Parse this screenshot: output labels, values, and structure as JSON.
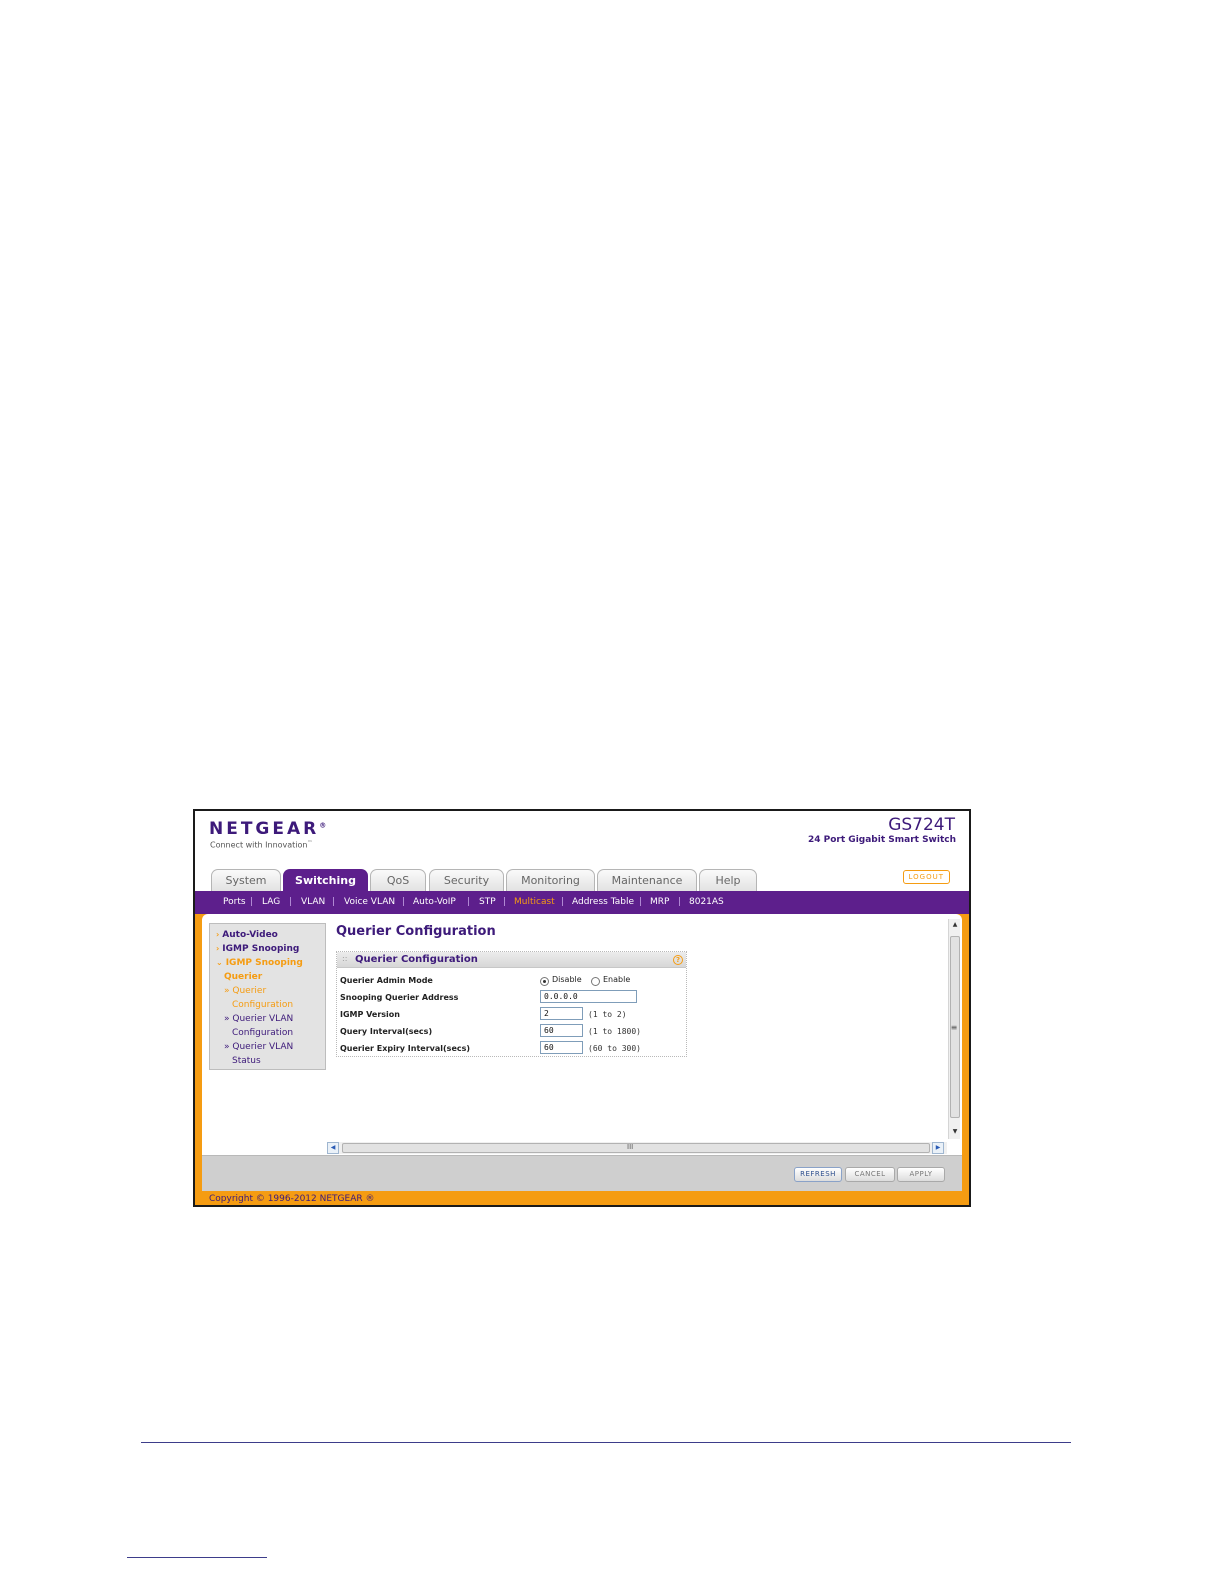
{
  "brand": {
    "logo": "NETGEAR",
    "logo_mark": "®",
    "tagline": "Connect with Innovation",
    "tagline_mark": "™",
    "model": "GS724T",
    "model_desc": "24 Port Gigabit Smart Switch"
  },
  "tabs": [
    {
      "label": "System"
    },
    {
      "label": "Switching"
    },
    {
      "label": "QoS"
    },
    {
      "label": "Security"
    },
    {
      "label": "Monitoring"
    },
    {
      "label": "Maintenance"
    },
    {
      "label": "Help"
    }
  ],
  "active_tab": "Switching",
  "logout_label": "LOGOUT",
  "subnav": [
    {
      "label": "Ports"
    },
    {
      "label": "LAG"
    },
    {
      "label": "VLAN"
    },
    {
      "label": "Voice VLAN"
    },
    {
      "label": "Auto-VoIP"
    },
    {
      "label": "STP"
    },
    {
      "label": "Multicast"
    },
    {
      "label": "Address Table"
    },
    {
      "label": "MRP"
    },
    {
      "label": "8021AS"
    }
  ],
  "subnav_separator": "|",
  "active_subnav": "Multicast",
  "sidebar": {
    "items": [
      {
        "label": "Auto-Video"
      },
      {
        "label": "IGMP Snooping"
      },
      {
        "label": "IGMP Snooping"
      },
      {
        "label": "Querier"
      }
    ],
    "subitems": [
      {
        "label": "Querier"
      },
      {
        "label": "Configuration"
      },
      {
        "label": "Querier VLAN"
      },
      {
        "label": "Configuration"
      },
      {
        "label": "Querier VLAN"
      },
      {
        "label": "Status"
      }
    ],
    "chevron_collapsed": "›",
    "chevron_expanded": "⌄",
    "sub_bullet": "»"
  },
  "page_title": "Querier Configuration",
  "panel": {
    "title": "Querier Configuration",
    "help_icon": "?",
    "rows": {
      "admin_mode": {
        "label": "Querier Admin Mode",
        "options": [
          "Disable",
          "Enable"
        ],
        "selected": "Disable"
      },
      "address": {
        "label": "Snooping Querier Address",
        "value": "0.0.0.0"
      },
      "version": {
        "label": "IGMP Version",
        "value": "2",
        "range": "(1 to 2)"
      },
      "interval": {
        "label": "Query Interval(secs)",
        "value": "60",
        "range": "(1 to 1800)"
      },
      "expiry": {
        "label": "Querier Expiry Interval(secs)",
        "value": "60",
        "range": "(60 to 300)"
      }
    }
  },
  "scroll": {
    "up": "▲",
    "down": "▼",
    "left": "◀",
    "right": "▶",
    "grip_v": "≡",
    "grip_h": "III"
  },
  "buttons": {
    "refresh": "REFRESH",
    "cancel": "CANCEL",
    "apply": "APPLY"
  },
  "copyright": "Copyright © 1996-2012 NETGEAR ®",
  "colors": {
    "purple": "#5d1f8c",
    "orange": "#f59c12",
    "navy_text": "#3d1a7a"
  }
}
